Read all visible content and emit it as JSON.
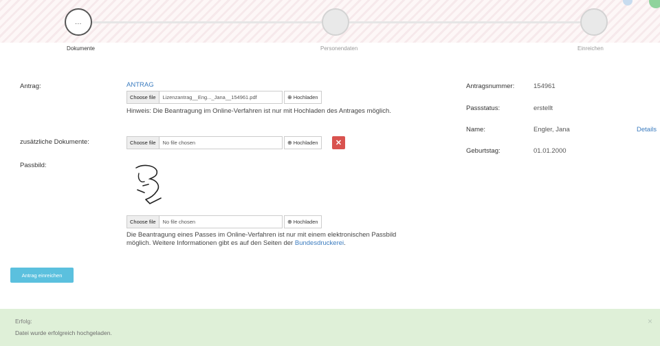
{
  "stepper": {
    "steps": [
      {
        "label": "Dokumente",
        "indicator": "...",
        "active": true
      },
      {
        "label": "Personendaten",
        "active": false
      },
      {
        "label": "Einreichen",
        "active": false
      }
    ]
  },
  "form": {
    "antrag": {
      "label": "Antrag:",
      "link_text": "ANTRAG",
      "choose_label": "Choose file",
      "file_name": "Lizenzantrag__Eng..._Jana__154961.pdf",
      "upload_label": "Hochladen",
      "hint": "Hinweis: Die Beantragung im Online-Verfahren ist nur mit Hochladen des Antrages möglich."
    },
    "zusatz": {
      "label": "zusätzliche Dokumente:",
      "choose_label": "Choose file",
      "file_name": "No file chosen",
      "upload_label": "Hochladen",
      "delete_icon": "close-icon"
    },
    "passbild": {
      "label": "Passbild:",
      "choose_label": "Choose file",
      "file_name": "No file chosen",
      "upload_label": "Hochladen",
      "hint_text": "Die Beantragung eines Passes im Online-Verfahren ist nur mit einem elektronischen Passbild möglich. Weitere Informationen gibt es auf den Seiten der ",
      "hint_link": "Bundesdruckerei",
      "hint_end": "."
    },
    "submit_label": "Antrag einreichen"
  },
  "info": {
    "rows": [
      {
        "label": "Antragsnummer:",
        "value": "154961"
      },
      {
        "label": "Passstatus:",
        "value": "erstellt"
      },
      {
        "label": "Name:",
        "value": "Engler, Jana",
        "link": "Details"
      },
      {
        "label": "Geburtstag:",
        "value": "01.01.2000"
      }
    ]
  },
  "alert": {
    "title": "Erfolg:",
    "message": "Datei wurde erfolgreich hochgeladen.",
    "close": "×"
  },
  "colors": {
    "submit": "#5bc0de",
    "delete": "#d9534f",
    "alert_bg": "#dff0d8",
    "link": "#3a7bbf"
  }
}
